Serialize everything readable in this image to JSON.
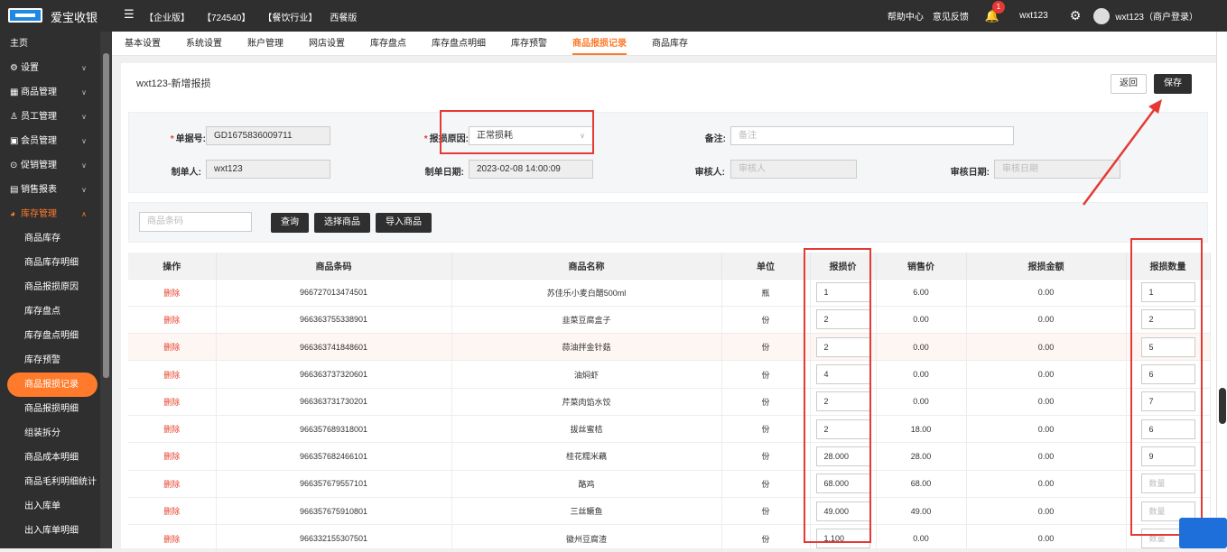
{
  "header": {
    "brand": "爱宝收银",
    "nav": [
      "【企业版】",
      "【724540】",
      "【餐饮行业】",
      "西餐版"
    ],
    "help": "帮助中心",
    "feedback": "意见反馈",
    "notification_count": "1",
    "user": "wxt123",
    "account": "wxt123（商户登录）"
  },
  "sidebar": {
    "home": "主页",
    "menus": [
      {
        "label": "设置"
      },
      {
        "label": "商品管理"
      },
      {
        "label": "员工管理"
      },
      {
        "label": "会员管理"
      },
      {
        "label": "促销管理"
      },
      {
        "label": "销售报表"
      }
    ],
    "open_menu": "库存管理",
    "sub_items": [
      "商品库存",
      "商品库存明细",
      "商品报损原因",
      "库存盘点",
      "库存盘点明细",
      "库存预警",
      "商品报损记录",
      "商品报损明细",
      "组装拆分",
      "商品成本明细",
      "商品毛利明细统计",
      "出入库单",
      "出入库单明细"
    ],
    "active_index": 6
  },
  "tabs": [
    "基本设置",
    "系统设置",
    "账户管理",
    "网店设置",
    "库存盘点",
    "库存盘点明细",
    "库存预警",
    "商品报损记录",
    "商品库存"
  ],
  "active_tab": 7,
  "page": {
    "title": "wxt123-新增报损",
    "back_label": "返回",
    "save_label": "保存"
  },
  "form": {
    "doc_no_label": "单据号:",
    "doc_no_value": "GD1675836009711",
    "reason_label": "报损原因:",
    "reason_value": "正常损耗",
    "remark_label": "备注:",
    "remark_placeholder": "备注",
    "creator_label": "制单人:",
    "creator_value": "wxt123",
    "create_date_label": "制单日期:",
    "create_date_value": "2023-02-08 14:00:09",
    "auditor_label": "审核人:",
    "auditor_placeholder": "审核人",
    "audit_date_label": "审核日期:",
    "audit_date_placeholder": "审核日期"
  },
  "search": {
    "placeholder": "商品条码",
    "query_label": "查询",
    "select_label": "选择商品",
    "import_label": "导入商品"
  },
  "table": {
    "headers": [
      "操作",
      "商品条码",
      "商品名称",
      "单位",
      "报损价",
      "销售价",
      "报损金额",
      "报损数量"
    ],
    "delete_label": "删除",
    "qty_placeholder": "数量",
    "rows": [
      {
        "barcode": "966727013474501",
        "name": "苏佳乐小麦白醋500ml",
        "unit": "瓶",
        "loss_price": "1",
        "sale_price": "6.00",
        "amount": "0.00",
        "qty": "1"
      },
      {
        "barcode": "966363755338901",
        "name": "韭菜豆腐盒子",
        "unit": "份",
        "loss_price": "2",
        "sale_price": "0.00",
        "amount": "0.00",
        "qty": "2"
      },
      {
        "barcode": "966363741848601",
        "name": "蒜油拌金针菇",
        "unit": "份",
        "loss_price": "2",
        "sale_price": "0.00",
        "amount": "0.00",
        "qty": "5"
      },
      {
        "barcode": "966363737320601",
        "name": "油焖虾",
        "unit": "份",
        "loss_price": "4",
        "sale_price": "0.00",
        "amount": "0.00",
        "qty": "6"
      },
      {
        "barcode": "966363731730201",
        "name": "芹菜肉馅水饺",
        "unit": "份",
        "loss_price": "2",
        "sale_price": "0.00",
        "amount": "0.00",
        "qty": "7"
      },
      {
        "barcode": "966357689318001",
        "name": "拔丝蜜桔",
        "unit": "份",
        "loss_price": "2",
        "sale_price": "18.00",
        "amount": "0.00",
        "qty": "6"
      },
      {
        "barcode": "966357682466101",
        "name": "桂花糯米藕",
        "unit": "份",
        "loss_price": "28.000",
        "sale_price": "28.00",
        "amount": "0.00",
        "qty": "9"
      },
      {
        "barcode": "966357679557101",
        "name": "酪鸡",
        "unit": "份",
        "loss_price": "68.000",
        "sale_price": "68.00",
        "amount": "0.00",
        "qty": ""
      },
      {
        "barcode": "966357675910801",
        "name": "三丝鳜鱼",
        "unit": "份",
        "loss_price": "49.000",
        "sale_price": "49.00",
        "amount": "0.00",
        "qty": ""
      },
      {
        "barcode": "966332155307501",
        "name": "徽州豆腐渣",
        "unit": "份",
        "loss_price": "1.100",
        "sale_price": "0.00",
        "amount": "0.00",
        "qty": ""
      }
    ]
  },
  "colors": {
    "accent": "#ff7a2a",
    "dark": "#2f2f2f",
    "annotation": "#e53935"
  }
}
